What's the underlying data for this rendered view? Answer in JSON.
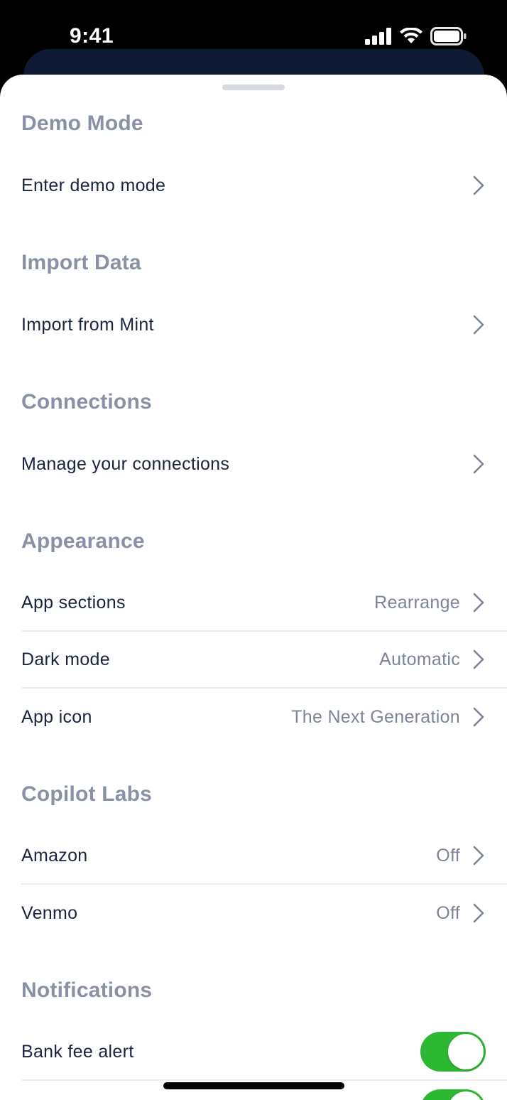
{
  "status_bar": {
    "time": "9:41",
    "icons": [
      "cellular-signal-icon",
      "wifi-icon",
      "battery-icon"
    ]
  },
  "sections": {
    "demo": {
      "title": "Demo Mode",
      "rows": [
        {
          "label": "Enter demo mode"
        }
      ]
    },
    "import": {
      "title": "Import Data",
      "rows": [
        {
          "label": "Import from Mint"
        }
      ]
    },
    "connections": {
      "title": "Connections",
      "rows": [
        {
          "label": "Manage your connections"
        }
      ]
    },
    "appearance": {
      "title": "Appearance",
      "rows": [
        {
          "label": "App sections",
          "value": "Rearrange"
        },
        {
          "label": "Dark mode",
          "value": "Automatic"
        },
        {
          "label": "App icon",
          "value": "The Next Generation"
        }
      ]
    },
    "labs": {
      "title": "Copilot Labs",
      "rows": [
        {
          "label": "Amazon",
          "value": "Off"
        },
        {
          "label": "Venmo",
          "value": "Off"
        }
      ]
    },
    "notifications": {
      "title": "Notifications",
      "rows": [
        {
          "label": "Bank fee alert",
          "toggle_on": true
        },
        {
          "label": "",
          "toggle_on": true
        }
      ]
    }
  },
  "colors": {
    "toggle_on": "#2db834",
    "section_header": "#8a91a6",
    "row_label": "#1a2440",
    "row_value": "#7c8499",
    "back_card": "#0e1a33"
  }
}
